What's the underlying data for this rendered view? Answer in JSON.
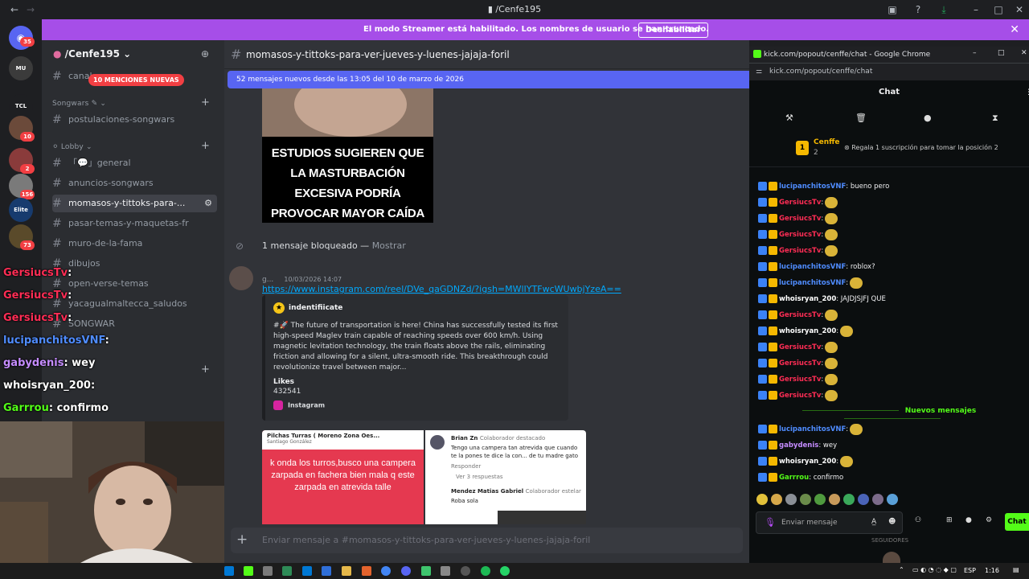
{
  "window": {
    "title": "/Cenfe195"
  },
  "banner": {
    "text": "El modo Streamer está habilitado. Los nombres de usuario se han truncado.",
    "button": "Deshabilitar"
  },
  "rail": {
    "top_badge": "35",
    "servers": [
      {
        "label": "MU",
        "color": "#3b3b3b"
      },
      {
        "label": "TCL",
        "color": "#1e1f22"
      },
      {
        "label": "",
        "color": "#6b4a3a",
        "badge": "10"
      },
      {
        "label": "",
        "color": "#8a3b3b",
        "badge": "2"
      },
      {
        "label": "",
        "color": "#7a7a7a",
        "badge": "156"
      },
      {
        "label": "Elite",
        "color": "#173b6e"
      },
      {
        "label": "",
        "color": "#5a4a2a",
        "badge": "73"
      }
    ]
  },
  "sidebar": {
    "server_name": "/Cenfe195",
    "mentions_pill": "10 MENCIONES NUEVAS",
    "top_channel": "canal",
    "cat_songwars": "Songwars",
    "postulaciones": "postulaciones-songwars",
    "cat_lobby": "Lobby",
    "channels": [
      "「💬」general",
      "anuncios-songwars",
      "momasos-y-tittoks-para-...",
      "pasar-temas-y-maquetas-fr",
      "muro-de-la-fama",
      "dibujos",
      "open-verse-temas",
      "yacagualmaltecca_saludos",
      "SONGWAR"
    ]
  },
  "overlay_chat": [
    {
      "user": "GersiucsTv",
      "msg": ":",
      "color": "#ff2d55"
    },
    {
      "user": "GersiucsTv",
      "msg": ":",
      "color": "#ff2d55"
    },
    {
      "user": "GersiucsTv",
      "msg": ":",
      "color": "#ff2d55"
    },
    {
      "user": "lucipanchitosVNF",
      "msg": ":",
      "color": "#4f8cff"
    },
    {
      "user": "gabydenis",
      "msg": ": wey",
      "color": "#c58cff"
    },
    {
      "user": "whoisryan_200",
      "msg": ":",
      "color": "#ffffff"
    },
    {
      "user": "Garrrou",
      "msg": ": confirmo",
      "color": "#53fc18"
    }
  ],
  "main": {
    "channel": "momasos-y-tittoks-para-ver-jueves-y-luenes-jajaja-foril",
    "new_messages": "52 mensajes nuevos desde las 13:05 del 10 de marzo de 2026",
    "meme_text": "ESTUDIOS SUGIEREN QUE LA MASTURBACIÓN EXCESIVA PODRÍA PROVOCAR MAYOR CAÍDA DEL CABELLO",
    "blocked": "1 mensaje bloqueado —",
    "blocked_link": "Mostrar",
    "author": "g...",
    "timestamp": "10/03/2026 14:07",
    "link": "https://www.instagram.com/reel/DVe_qaGDNZd/?igsh=MWlIYTFwcWUwbjYzeA==",
    "embed": {
      "author": "indentifiicate",
      "desc": "#🚀 The future of transportation is here! China has successfully tested its first high-speed Maglev train capable of reaching speeds over 600 km/h. Using magnetic levitation technology, the train floats above the rails, eliminating friction and allowing for a silent, ultra-smooth ride. This breakthrough could revolutionize travel between major...",
      "field_name": "Likes",
      "field_value": "432541",
      "footer": "Instagram"
    },
    "img1": {
      "header": "Pilchas Turras ( Moreno Zona Oes...",
      "sub": "Santiago González",
      "body": "k onda los turros,busco una campera zarpada en fachera bien mala q este zarpada en atrevida talle"
    },
    "img2": {
      "name": "Brian Zn",
      "tag": "Colaborador destacado",
      "comment": "Tengo una campera tan atrevida que cuando te la pones te dice la con... de tu madre gato",
      "reply": "Responder",
      "replies": "Ver 3 respuestas",
      "name2": "Mendez Matias Gabriel",
      "tag2": "Colaborador estelar",
      "comment2": "Roba sola"
    },
    "composer_placeholder": "Enviar mensaje a #momasos-y-tittoks-para-ver-jueves-y-luenes-jajaja-foril"
  },
  "kick": {
    "window_title": "kick.com/popout/cenffe/chat - Google Chrome",
    "url": "kick.com/popout/cenffe/chat",
    "chat_title": "Chat",
    "leader_rank": "1",
    "leader_name": "Cenffe",
    "leader_count": "2",
    "gift_text": "Regala 1 suscripción para tomar la posición 2",
    "messages": [
      {
        "user": "lucipanchitosVNF",
        "msg": ": bueno pero",
        "color": "#4f8cff",
        "emote": false
      },
      {
        "user": "GersiucsTv",
        "msg": ":",
        "color": "#ff2d55",
        "emote": true
      },
      {
        "user": "GersiucsTv",
        "msg": ":",
        "color": "#ff2d55",
        "emote": true
      },
      {
        "user": "GersiucsTv",
        "msg": ":",
        "color": "#ff2d55",
        "emote": true
      },
      {
        "user": "GersiucsTv",
        "msg": ":",
        "color": "#ff2d55",
        "emote": true
      },
      {
        "user": "lucipanchitosVNF",
        "msg": ": roblox?",
        "color": "#4f8cff",
        "emote": false
      },
      {
        "user": "lucipanchitosVNF",
        "msg": ":",
        "color": "#4f8cff",
        "emote": true
      },
      {
        "user": "whoisryan_200",
        "msg": ": JAJDJSJFJ QUE",
        "color": "#ffffff",
        "emote": false
      },
      {
        "user": "GersiucsTv",
        "msg": ":",
        "color": "#ff2d55",
        "emote": true
      },
      {
        "user": "whoisryan_200",
        "msg": ":",
        "color": "#ffffff",
        "emote": true
      },
      {
        "user": "GersiucsTv",
        "msg": ":",
        "color": "#ff2d55",
        "emote": true
      },
      {
        "user": "GersiucsTv",
        "msg": ":",
        "color": "#ff2d55",
        "emote": true
      },
      {
        "user": "GersiucsTv",
        "msg": ":",
        "color": "#ff2d55",
        "emote": true
      },
      {
        "user": "GersiucsTv",
        "msg": ":",
        "color": "#ff2d55",
        "emote": true
      }
    ],
    "new_messages": "Nuevos mensajes",
    "messages_after": [
      {
        "user": "lucipanchitosVNF",
        "msg": ":",
        "color": "#4f8cff",
        "emote": true
      },
      {
        "user": "gabydenis",
        "msg": ": wey",
        "color": "#c58cff",
        "emote": false
      },
      {
        "user": "whoisryan_200",
        "msg": ":",
        "color": "#ffffff",
        "emote": true
      },
      {
        "user": "Garrrou",
        "msg": ": confirmo",
        "color": "#53fc18",
        "emote": false
      }
    ],
    "input_placeholder": "Enviar mensaje",
    "send_button": "Chat",
    "seguidores": "SEGUIDORES"
  },
  "taskbar": {
    "lang": "ESP",
    "time": "1:16"
  },
  "colors": {
    "discord_blurple": "#5865f2",
    "streamer_banner": "#a64ee8",
    "kick_green": "#53fc18"
  }
}
